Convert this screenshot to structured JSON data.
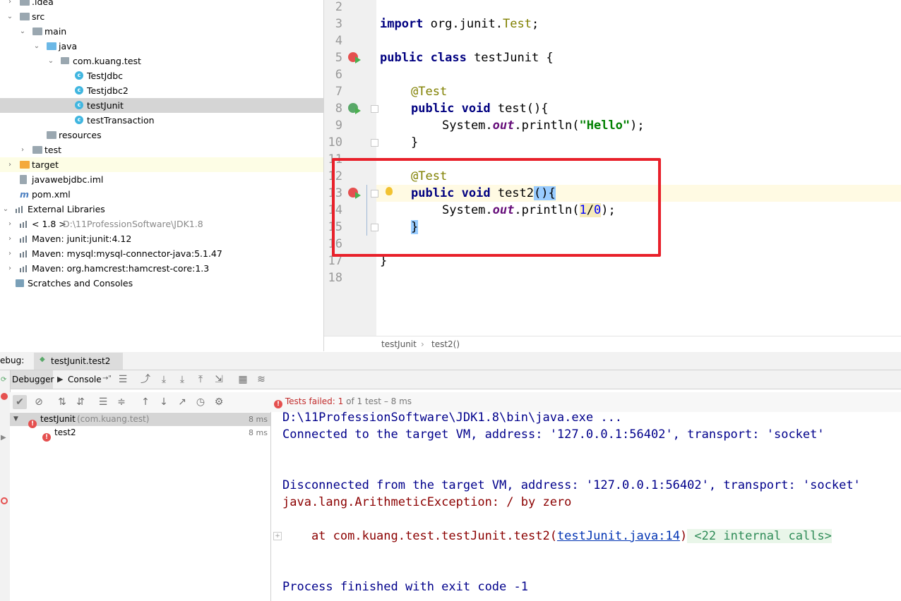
{
  "project_tree": [
    {
      "label": ".idea",
      "indent": 1,
      "icon": "folder",
      "arrow": "right"
    },
    {
      "label": "src",
      "indent": 1,
      "icon": "folder",
      "arrow": "down"
    },
    {
      "label": "main",
      "indent": 2,
      "icon": "folder",
      "arrow": "down"
    },
    {
      "label": "java",
      "indent": 3,
      "icon": "source-folder",
      "arrow": "down"
    },
    {
      "label": "com.kuang.test",
      "indent": 4,
      "icon": "package",
      "arrow": "down"
    },
    {
      "label": "TestJdbc",
      "indent": 5,
      "icon": "class"
    },
    {
      "label": "Testjdbc2",
      "indent": 5,
      "icon": "class"
    },
    {
      "label": "testJunit",
      "indent": 5,
      "icon": "class",
      "selected": true
    },
    {
      "label": "testTransaction",
      "indent": 5,
      "icon": "class"
    },
    {
      "label": "resources",
      "indent": 3,
      "icon": "resources-folder"
    },
    {
      "label": "test",
      "indent": 2,
      "icon": "folder",
      "arrow": "right"
    },
    {
      "label": "target",
      "indent": 1,
      "icon": "target-folder",
      "arrow": "right",
      "highlight": true
    },
    {
      "label": "javawebjdbc.iml",
      "indent": 1,
      "icon": "iml-file"
    },
    {
      "label": "pom.xml",
      "indent": 1,
      "icon": "maven-file"
    },
    {
      "label": "External Libraries",
      "indent": 0,
      "icon": "library",
      "arrow": "down"
    },
    {
      "label": "< 1.8 >",
      "path": "D:\\11ProfessionSoftware\\JDK1.8",
      "indent": 1,
      "icon": "jdk",
      "arrow": "right"
    },
    {
      "label": "Maven: junit:junit:4.12",
      "indent": 1,
      "icon": "library",
      "arrow": "right"
    },
    {
      "label": "Maven: mysql:mysql-connector-java:5.1.47",
      "indent": 1,
      "icon": "library",
      "arrow": "right"
    },
    {
      "label": "Maven: org.hamcrest:hamcrest-core:1.3",
      "indent": 1,
      "icon": "library",
      "arrow": "right"
    },
    {
      "label": "Scratches and Consoles",
      "indent": 0,
      "icon": "scratches"
    }
  ],
  "editor": {
    "line_numbers": [
      "2",
      "3",
      "4",
      "5",
      "6",
      "7",
      "8",
      "9",
      "10",
      "11",
      "12",
      "13",
      "14",
      "15",
      "16",
      "17",
      "18"
    ],
    "code": {
      "import_kw": "import",
      "import_pkg": " org.junit.",
      "import_cls": "Test",
      "import_end": ";",
      "class_kw": "public class",
      "class_name": " testJunit {",
      "ann1": "@Test",
      "m1_kw": "public void",
      "m1_name": " test(){",
      "print1_a": "System.",
      "print1_out": "out",
      "print1_b": ".println(",
      "print1_str": "\"Hello\"",
      "print1_end": ");",
      "close1": "}",
      "ann2": "@Test",
      "m2_kw": "public void",
      "m2_name": " test2",
      "m2_parens": "(){",
      "print2_a": "System.",
      "print2_out": "out",
      "print2_b": ".println(",
      "print2_num1": "1",
      "print2_div": "/",
      "print2_num2": "0",
      "print2_end": ");",
      "close2": "}",
      "close_class": "}"
    }
  },
  "breadcrumb": {
    "class": "testJunit",
    "sep": "›",
    "method": "test2()"
  },
  "debug": {
    "label": "ebug:",
    "tab": "testJunit.test2",
    "subtabs": {
      "debugger": "Debugger",
      "console": "Console",
      "console_suffix": "→\""
    },
    "status": {
      "prefix": "Tests failed:",
      "failed": "1",
      "rest": "of 1 test – 8 ms"
    }
  },
  "tests": [
    {
      "name": "testJunit",
      "pkg": "(com.kuang.test)",
      "time": "8 ms"
    },
    {
      "name": "test2",
      "time": "8 ms"
    }
  ],
  "console": {
    "l1": "D:\\11ProfessionSoftware\\JDK1.8\\bin\\java.exe ...",
    "l2": "Connected to the target VM, address: '127.0.0.1:56402', transport: 'socket'",
    "l3": "Disconnected from the target VM, address: '127.0.0.1:56402', transport: 'socket'",
    "l4": "java.lang.ArithmeticException: / by zero",
    "l5_prefix": "    at com.kuang.test.testJunit.test2(",
    "l5_link": "testJunit.java:14",
    "l5_suffix": ")",
    "l5_internal": " <22 internal calls>",
    "l6": "Process finished with exit code -1"
  },
  "colors": {
    "annotation_box": "#e8202a",
    "error": "#e5504f"
  }
}
